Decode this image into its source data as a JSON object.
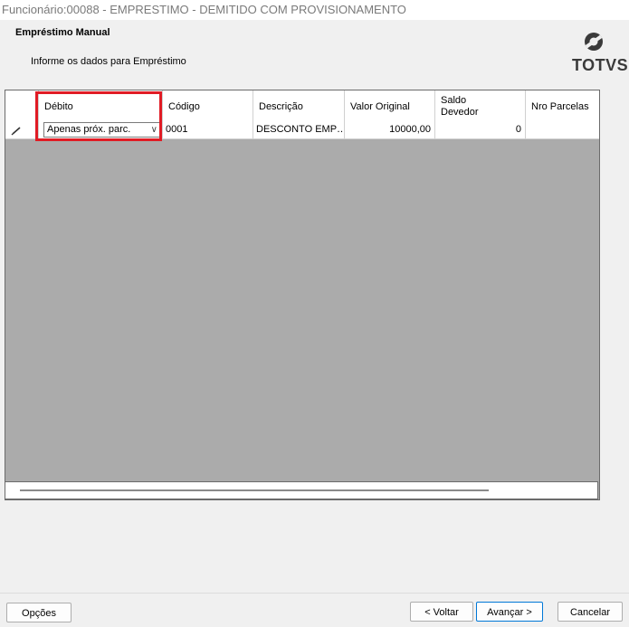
{
  "window": {
    "title": "Funcionário:00088 - EMPRESTIMO - DEMITIDO COM PROVISIONAMENTO"
  },
  "header": {
    "title": "Empréstimo Manual",
    "subtitle": "Informe os dados para Empréstimo",
    "logo_text": "TOTVS"
  },
  "grid": {
    "columns": [
      {
        "label": ""
      },
      {
        "label": "Débito"
      },
      {
        "label": "Código"
      },
      {
        "label": "Descrição"
      },
      {
        "label": "Valor Original"
      },
      {
        "label": "Saldo Devedor"
      },
      {
        "label": "Nro Parcelas"
      }
    ],
    "rows": [
      {
        "indicator": "edit-pencil-icon",
        "debito": "Apenas próx. parc.",
        "codigo": "0001",
        "descricao": "DESCONTO EMP…",
        "valor_original": "10000,00",
        "saldo_devedor": "0",
        "nro_parcelas": ""
      }
    ]
  },
  "footer": {
    "opcoes_label": "Opções",
    "voltar_label": "< Voltar",
    "avancar_label": "Avançar >",
    "cancelar_label": "Cancelar"
  },
  "colors": {
    "highlight": "#e01b24",
    "grid_background": "#ababab",
    "panel": "#f0f0f0"
  }
}
